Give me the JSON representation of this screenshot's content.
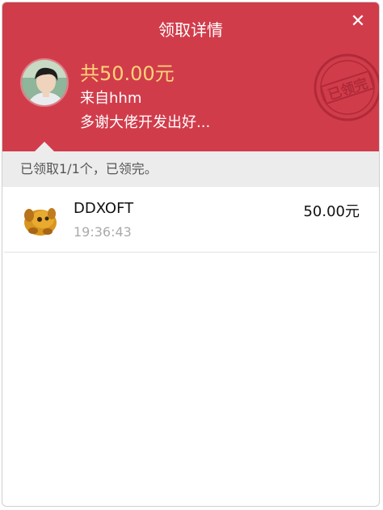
{
  "header": {
    "title": "领取详情",
    "close_label": "✕",
    "total_amount": "共50.00元",
    "from_text": "来自hhm",
    "message": "多谢大佬开发出好...",
    "stamp_text": "已领完"
  },
  "status": {
    "text": "已领取1/1个，已领完。"
  },
  "records": [
    {
      "name": "DDXOFT",
      "time": "19:36:43",
      "amount": "50.00元"
    }
  ],
  "colors": {
    "header_bg": "#d13c4b",
    "amount_gold": "#ffd27a",
    "status_bg": "#ececec"
  }
}
